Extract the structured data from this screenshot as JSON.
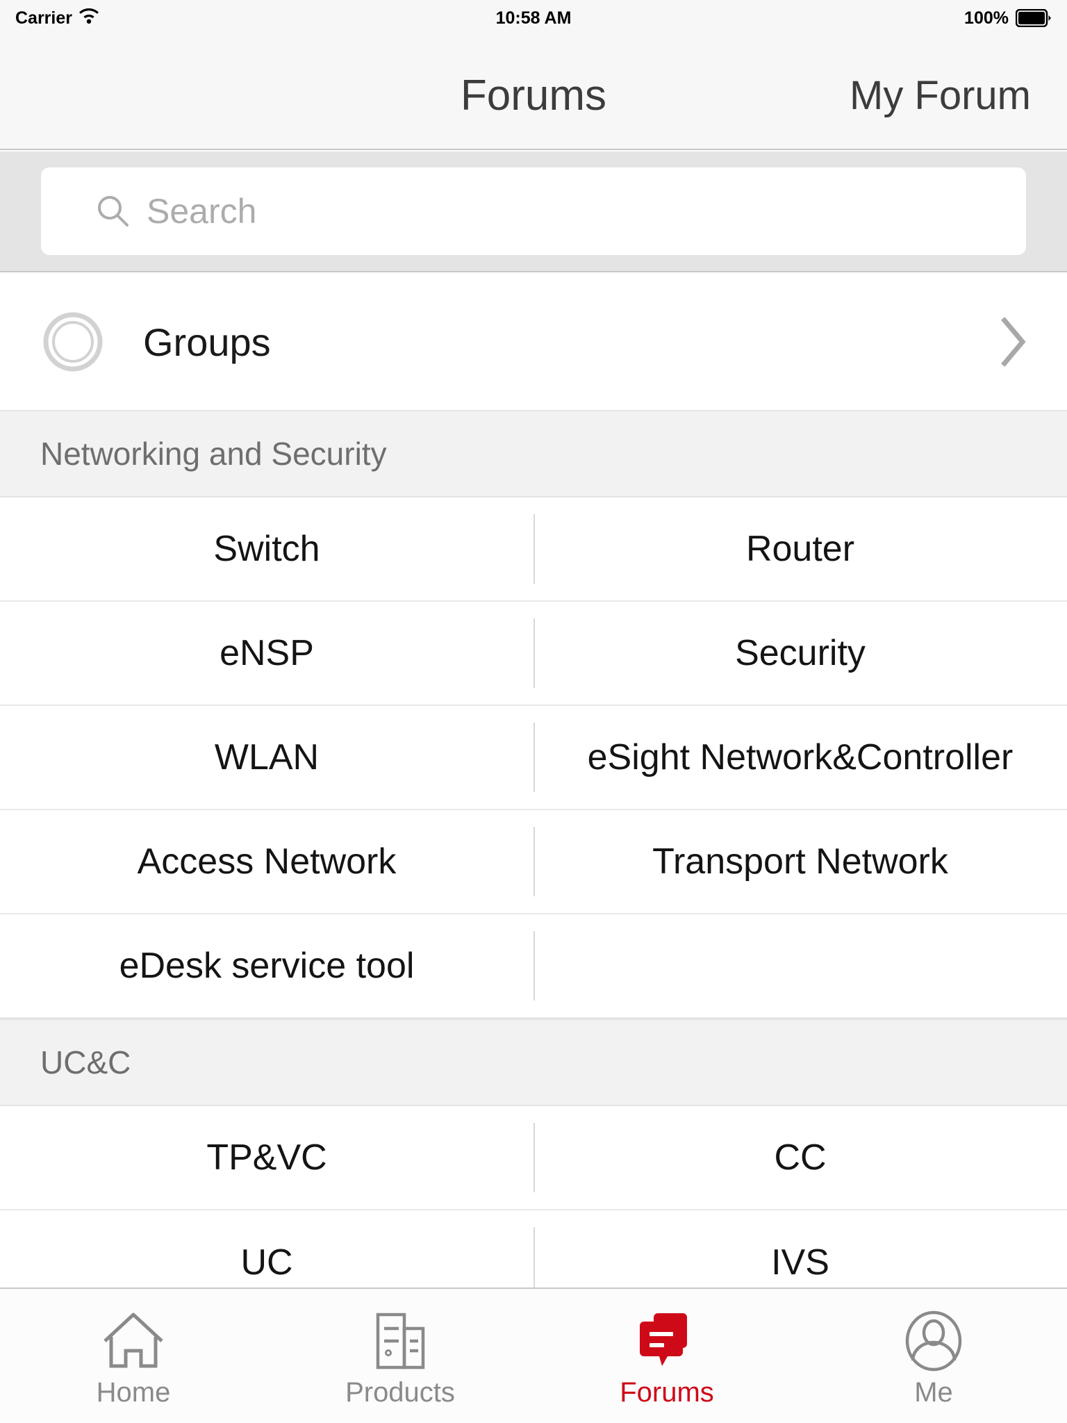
{
  "status_bar": {
    "carrier": "Carrier",
    "time": "10:58 AM",
    "battery_percent": "100%",
    "wifi_icon": "wifi-icon",
    "battery_icon": "battery-full-icon"
  },
  "nav_bar": {
    "title": "Forums",
    "right_button": "My Forum"
  },
  "search": {
    "placeholder": "Search",
    "value": "",
    "icon": "search-icon"
  },
  "groups_row": {
    "label": "Groups",
    "icon": "circle-ring-icon",
    "chevron": "chevron-right-icon"
  },
  "sections": [
    {
      "title": "Networking and Security",
      "rows": [
        [
          "Switch",
          "Router"
        ],
        [
          "eNSP",
          "Security"
        ],
        [
          "WLAN",
          "eSight Network&Controller"
        ],
        [
          "Access Network",
          "Transport Network"
        ],
        [
          "eDesk service tool",
          ""
        ]
      ]
    },
    {
      "title": "UC&C",
      "rows": [
        [
          "TP&VC",
          "CC"
        ],
        [
          "UC",
          "IVS"
        ]
      ]
    }
  ],
  "tab_bar": {
    "tabs": [
      {
        "label": "Home",
        "icon": "home-icon",
        "active": false
      },
      {
        "label": "Products",
        "icon": "products-icon",
        "active": false
      },
      {
        "label": "Forums",
        "icon": "forums-icon",
        "active": true
      },
      {
        "label": "Me",
        "icon": "person-icon",
        "active": false
      }
    ]
  },
  "colors": {
    "accent": "#CE0A18",
    "nav_bg": "#F7F7F7",
    "search_bg": "#E4E4E4",
    "section_header_bg": "#F2F2F2",
    "separator": "#C8C8CA",
    "text_primary": "#141414",
    "text_secondary": "#6E6E6E",
    "placeholder": "#ACACAC",
    "tab_inactive": "#8A8A8A"
  }
}
